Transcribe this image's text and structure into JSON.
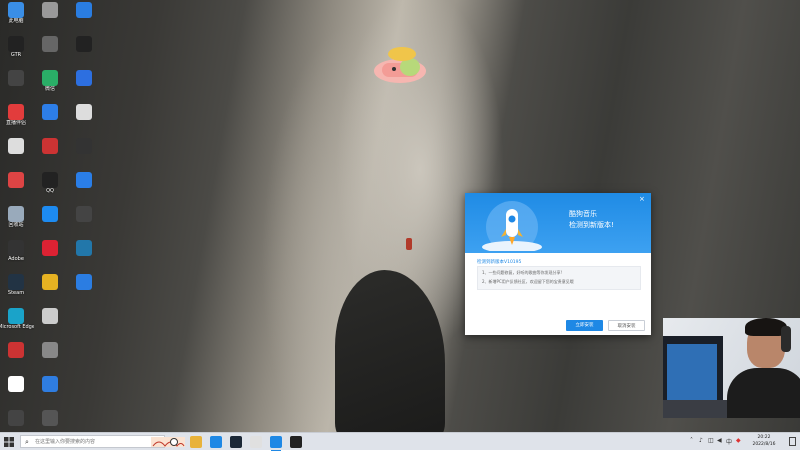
{
  "desktop": {
    "icons": [
      {
        "label": "此电脑",
        "color": "#3a8ee6"
      },
      {
        "label": "GTR",
        "color": "#222"
      },
      {
        "label": "",
        "color": "#444"
      },
      {
        "label": "直播伴侣",
        "color": "#e23c3c"
      },
      {
        "label": "",
        "color": "#ddd"
      },
      {
        "label": "",
        "color": "#d44"
      },
      {
        "label": "回收站",
        "color": "#9ab"
      },
      {
        "label": "Adobe",
        "color": "#333"
      },
      {
        "label": "Steam",
        "color": "#234"
      },
      {
        "label": "Microsoft Edge",
        "color": "#1aa3c9"
      },
      {
        "label": "",
        "color": "#c33"
      },
      {
        "label": "",
        "color": "#fff"
      },
      {
        "label": "",
        "color": "#444"
      },
      {
        "label": "",
        "color": "#999"
      },
      {
        "label": "",
        "color": "#666"
      },
      {
        "label": "微信",
        "color": "#2aae67"
      },
      {
        "label": "",
        "color": "#2d7ee8"
      },
      {
        "label": "",
        "color": "#c33"
      },
      {
        "label": "QQ",
        "color": "#222"
      },
      {
        "label": "",
        "color": "#1d8bf1"
      },
      {
        "label": "",
        "color": "#d23"
      },
      {
        "label": "",
        "color": "#e6b222"
      },
      {
        "label": "",
        "color": "#ccc"
      },
      {
        "label": "",
        "color": "#888"
      },
      {
        "label": "",
        "color": "#2f7de1"
      },
      {
        "label": "",
        "color": "#555"
      },
      {
        "label": "",
        "color": "#2a7de1"
      },
      {
        "label": "",
        "color": "#222"
      },
      {
        "label": "",
        "color": "#2d6fe0"
      },
      {
        "label": "",
        "color": "#ddd"
      },
      {
        "label": "",
        "color": "#333"
      },
      {
        "label": "",
        "color": "#2a7ee8"
      },
      {
        "label": "",
        "color": "#444"
      },
      {
        "label": "",
        "color": "#27a"
      },
      {
        "label": "",
        "color": "#2b7de2"
      }
    ]
  },
  "dialog": {
    "title": "酷狗音乐",
    "subtitle": "检测到新版本!",
    "close_glyph": "×",
    "version_label": "检测到新版本V10195",
    "notes": [
      "1、一些问题修复，好听的歌曲等你发现分享!",
      "2、新增PC用户反馈社区，欢迎留下您的宝贵意见哦"
    ],
    "install_label": "立即安装",
    "cancel_label": "取消安装"
  },
  "taskbar": {
    "search_placeholder": "在这里输入你要搜索的内容",
    "apps": [
      {
        "name": "task-view",
        "color": "#ffffff"
      },
      {
        "name": "file-explorer",
        "color": "#e8b23a"
      },
      {
        "name": "kugou",
        "color": "#1e88e5"
      },
      {
        "name": "steam",
        "color": "#1b2838"
      },
      {
        "name": "app-4",
        "color": "#e0e0e0"
      },
      {
        "name": "kugou-music",
        "color": "#1e88e5"
      },
      {
        "name": "obs",
        "color": "#222222"
      }
    ],
    "clock_time": "20:22",
    "clock_date": "2022/8/16"
  }
}
